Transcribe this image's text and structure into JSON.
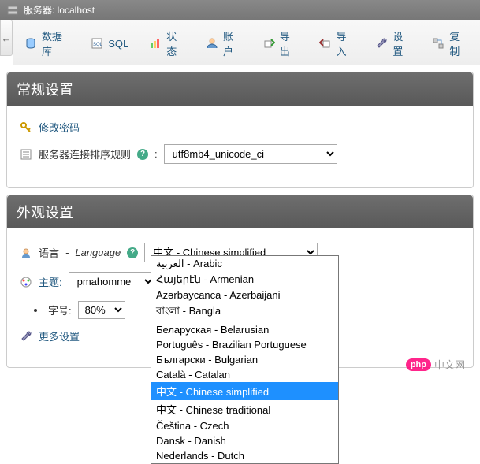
{
  "titlebar": {
    "label": "服务器: localhost"
  },
  "tabs": {
    "database": "数据库",
    "sql": "SQL",
    "status": "状态",
    "accounts": "账户",
    "export": "导出",
    "import": "导入",
    "settings": "设置",
    "replication": "复制"
  },
  "panels": {
    "general": {
      "title": "常规设置",
      "change_password": "修改密码",
      "collation_label": "服务器连接排序规则",
      "collation_value": "utf8mb4_unicode_ci"
    },
    "appearance": {
      "title": "外观设置",
      "language_label_zh": "语言",
      "language_label_en": "Language",
      "language_selected": "中文 - Chinese simplified",
      "language_options": [
        "العربية - Arabic",
        "Հայերէն - Armenian",
        "Azərbaycanca - Azerbaijani",
        "বাংলা - Bangla",
        "Беларуская - Belarusian",
        "Português - Brazilian Portuguese",
        "Български - Bulgarian",
        "Català - Catalan",
        "中文 - Chinese simplified",
        "中文 - Chinese traditional",
        "Čeština - Czech",
        "Dansk - Danish",
        "Nederlands - Dutch"
      ],
      "theme_label": "主题:",
      "theme_value": "pmahomme",
      "fontsize_label": "字号:",
      "fontsize_value": "80%",
      "more_settings": "更多设置"
    }
  },
  "watermark": {
    "badge": "php",
    "text": "中文网"
  }
}
